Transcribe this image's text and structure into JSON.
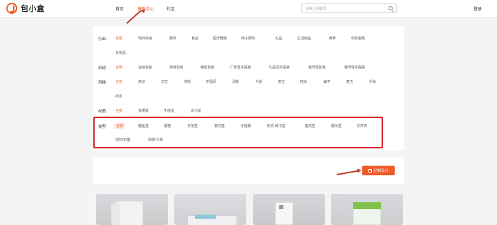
{
  "header": {
    "logo_text": "包小盒",
    "nav": [
      {
        "label": "首页",
        "active": false
      },
      {
        "label": "模板中心",
        "active": true
      },
      {
        "label": "社区",
        "active": false
      }
    ],
    "search_placeholder": "请输入关键词",
    "login_label": "登录"
  },
  "filters": {
    "industry": {
      "label": "行业:",
      "options": [
        "全部",
        "电商快递",
        "服饰",
        "食品",
        "医疗器械",
        "电子数码",
        "礼品",
        "生活用品",
        "教育",
        "科技金融",
        "化妆品"
      ]
    },
    "usage": {
      "label": "用途:",
      "options": [
        "全部",
        "运输包装",
        "存储包装",
        "销售包装",
        "广告性手提袋",
        "礼品性手提袋",
        "装饰性包装",
        "装饰性手提袋"
      ]
    },
    "style": {
      "label": "风格:",
      "options": [
        "全部",
        "简洁",
        "文艺",
        "传统",
        "中国风",
        "清新",
        "卡通",
        "复古",
        "时尚",
        "扁平",
        "复古",
        "手绘",
        "商务"
      ]
    },
    "material": {
      "label": "材质:",
      "options": [
        "全部",
        "瓦楞纸",
        "牛皮纸",
        "白卡纸"
      ]
    },
    "box_type": {
      "label": "盒型:",
      "options": [
        "全部",
        "翻盖盒",
        "纸箱",
        "天地盒",
        "管式盒",
        "手提袋",
        "管式-纸巾盒",
        "盘式盒",
        "展示盒",
        "文件夹",
        "信封/封套",
        "吊牌/卡牌"
      ]
    }
  },
  "actions": {
    "design_button_label": "定制设计"
  },
  "colors": {
    "accent": "#ef5a2a",
    "annotation_red": "#d6232b"
  }
}
